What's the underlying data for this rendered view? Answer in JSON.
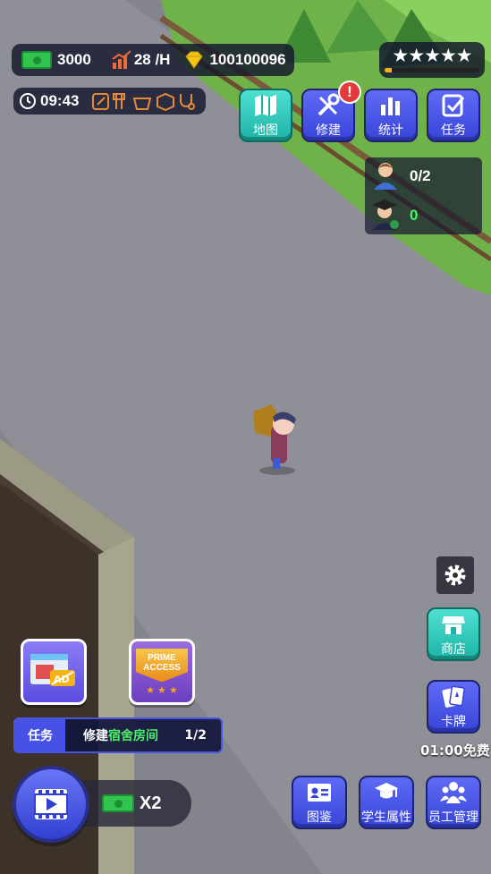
{
  "hud": {
    "cash": "3000",
    "income": "28 /H",
    "gems": "100100096",
    "time": "09:43",
    "rating_stars": 5,
    "rating_progress": 0.08
  },
  "top_buttons": [
    {
      "label": "地图",
      "icon": "map-icon"
    },
    {
      "label": "修建",
      "icon": "build-tools-icon",
      "alert": "!"
    },
    {
      "label": "统计",
      "icon": "bar-chart-icon"
    },
    {
      "label": "任务",
      "icon": "checklist-icon"
    }
  ],
  "people": {
    "students": "0/2",
    "graduates": "0"
  },
  "right_buttons": {
    "shop": "商店",
    "cards": "卡牌",
    "cards_timer": "01:00免费"
  },
  "mission": {
    "tag": "任务",
    "text_prefix": "修建",
    "text_highlight": "宿舍房间",
    "progress": "1/2"
  },
  "ad_reward": {
    "multiplier": "X2"
  },
  "bottom_buttons": [
    {
      "label": "图鉴",
      "icon": "id-card-icon"
    },
    {
      "label": "学生属性",
      "icon": "graduation-cap-icon"
    },
    {
      "label": "员工管理",
      "icon": "staff-group-icon"
    }
  ],
  "prime_access": {
    "line1": "PRIME",
    "line2": "ACCESS"
  },
  "colors": {
    "accent_blue": "#4652e6",
    "teal": "#2ec8ba",
    "cash_green": "#31c44f",
    "gem_yellow": "#f5c516",
    "highlight_green": "#4cf06a"
  }
}
